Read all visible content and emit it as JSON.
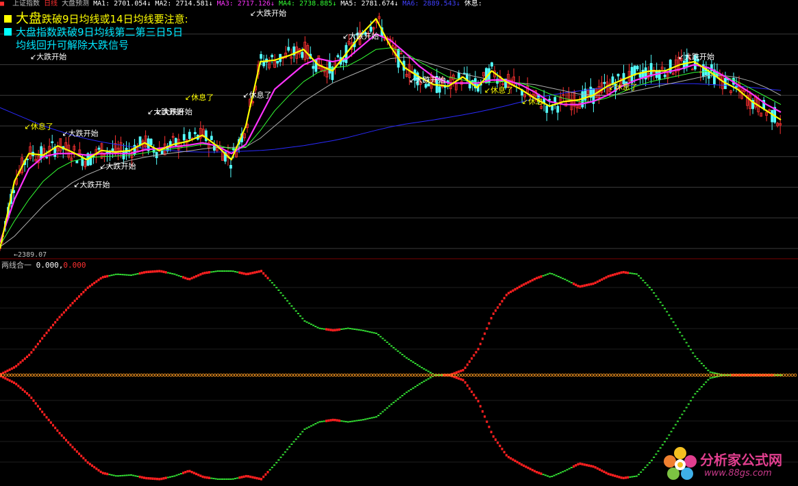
{
  "header": {
    "items": [
      {
        "text": "上证指数",
        "color": "#c0c0c0"
      },
      {
        "text": "日线",
        "color": "#ff3030"
      },
      {
        "text": "大盘预测",
        "color": "#c0c0c0"
      },
      {
        "text": "MA1: 2701.054↓",
        "color": "#ffffff"
      },
      {
        "text": "MA2: 2714.581↓",
        "color": "#ffffff"
      },
      {
        "text": "MA3: 2717.126↓",
        "color": "#ff33ff"
      },
      {
        "text": "MA4: 2738.885↓",
        "color": "#33ff33"
      },
      {
        "text": "MA5: 2781.674↓",
        "color": "#ffffff"
      },
      {
        "text": "MA6: 2889.543↓",
        "color": "#4040ff"
      },
      {
        "text": "休息:",
        "color": "#ffffff"
      }
    ]
  },
  "legend": {
    "line1_square_color": "#ffff00",
    "line1_big": "大盘",
    "line1_rest": "跌破9日均线或14日均线要注意:",
    "line2_square_color": "#00ffff",
    "line2": "大盘指数跌破9日均线第二第三日5日",
    "line3": "均线回升可解除大跌信号"
  },
  "main_chart": {
    "low_label": "2389.07",
    "y_range": [
      2380,
      3180
    ],
    "annotations": [
      {
        "text": "大跌开始",
        "x": 18,
        "y": 3018,
        "color": "#ffffff"
      },
      {
        "text": "大跌开始",
        "x": 40,
        "y": 2768,
        "color": "#ffffff"
      },
      {
        "text": "大跌开始",
        "x": 48,
        "y": 2600,
        "color": "#ffffff"
      },
      {
        "text": "大跌开始",
        "x": 66,
        "y": 2660,
        "color": "#ffffff"
      },
      {
        "text": "大跌开始",
        "x": 99,
        "y": 2838,
        "color": "#ffffff"
      },
      {
        "text": "大跌开始",
        "x": 105,
        "y": 2838,
        "color": "#ffffff"
      },
      {
        "text": "大跌开始",
        "x": 170,
        "y": 3160,
        "color": "#ffffff"
      },
      {
        "text": "大跌开始",
        "x": 234,
        "y": 3085,
        "color": "#ffffff"
      },
      {
        "text": "大跌开始",
        "x": 280,
        "y": 2942,
        "color": "#ffffff"
      },
      {
        "text": "大跌开始",
        "x": 466,
        "y": 3018,
        "color": "#ffffff"
      },
      {
        "text": "休息了",
        "x": 14,
        "y": 2790,
        "color": "#ffff00"
      },
      {
        "text": "休息了",
        "x": 125,
        "y": 2885,
        "color": "#ffff00"
      },
      {
        "text": "休息了",
        "x": 165,
        "y": 2893,
        "color": "#ffffff"
      },
      {
        "text": "休息了",
        "x": 332,
        "y": 2908,
        "color": "#ffff00"
      },
      {
        "text": "休息",
        "x": 358,
        "y": 2872,
        "color": "#ffff00"
      },
      {
        "text": "休息了",
        "x": 418,
        "y": 2918,
        "color": "#ffff00"
      }
    ]
  },
  "sub_chart": {
    "title": "两线合一",
    "value1": "0.000,",
    "value1_color": "#ffffff",
    "value2": "0.000",
    "value2_color": "#ff3030"
  },
  "chart_data": {
    "type": "line",
    "x": [
      0,
      10,
      20,
      30,
      40,
      50,
      60,
      70,
      80,
      90,
      100,
      110,
      120,
      130,
      140,
      150,
      160,
      170,
      180,
      190,
      200,
      210,
      220,
      230,
      240,
      250,
      260,
      270,
      280,
      290,
      300,
      310,
      320,
      330,
      340,
      350,
      360,
      370,
      380,
      390,
      400,
      410,
      420,
      430,
      440,
      450,
      460,
      470,
      480,
      490,
      500,
      510,
      520,
      530,
      540
    ],
    "series": [
      {
        "name": "MA1",
        "color": "#ffff00",
        "values": [
          2400,
          2620,
          2710,
          2705,
          2735,
          2715,
          2690,
          2720,
          2715,
          2720,
          2745,
          2720,
          2740,
          2750,
          2770,
          2735,
          2690,
          2800,
          3010,
          3015,
          3030,
          3050,
          3000,
          2980,
          3040,
          3100,
          3150,
          3060,
          2990,
          2960,
          2935,
          2930,
          2960,
          2925,
          2980,
          2945,
          2920,
          2890,
          2865,
          2880,
          2885,
          2900,
          2930,
          2950,
          2970,
          2980,
          2980,
          3000,
          3010,
          2980,
          2945,
          2920,
          2880,
          2850,
          2820
        ]
      },
      {
        "name": "MA3",
        "color": "#ff33ff",
        "values": [
          2420,
          2560,
          2660,
          2700,
          2710,
          2710,
          2705,
          2710,
          2710,
          2710,
          2722,
          2727,
          2732,
          2737,
          2745,
          2735,
          2710,
          2740,
          2830,
          2920,
          2960,
          3000,
          3020,
          3010,
          3020,
          3060,
          3100,
          3080,
          3040,
          2995,
          2960,
          2940,
          2940,
          2940,
          2950,
          2950,
          2935,
          2910,
          2880,
          2870,
          2870,
          2880,
          2900,
          2930,
          2950,
          2965,
          2975,
          2985,
          3000,
          2990,
          2965,
          2935,
          2905,
          2870,
          2845
        ]
      },
      {
        "name": "MA4",
        "color": "#33ff33",
        "values": [
          2410,
          2490,
          2560,
          2620,
          2660,
          2685,
          2695,
          2700,
          2702,
          2705,
          2712,
          2720,
          2726,
          2732,
          2740,
          2738,
          2725,
          2730,
          2785,
          2850,
          2900,
          2945,
          2975,
          2990,
          2995,
          3020,
          3050,
          3055,
          3040,
          3010,
          2985,
          2960,
          2950,
          2942,
          2943,
          2945,
          2940,
          2925,
          2905,
          2890,
          2880,
          2880,
          2892,
          2910,
          2930,
          2945,
          2955,
          2965,
          2975,
          2978,
          2965,
          2945,
          2920,
          2895,
          2870
        ]
      },
      {
        "name": "MA5",
        "color": "#b0b0b0",
        "values": [
          2405,
          2440,
          2490,
          2540,
          2580,
          2615,
          2640,
          2660,
          2675,
          2688,
          2698,
          2706,
          2712,
          2718,
          2725,
          2730,
          2730,
          2732,
          2760,
          2800,
          2840,
          2880,
          2910,
          2940,
          2960,
          2980,
          3000,
          3020,
          3025,
          3015,
          3000,
          2985,
          2970,
          2960,
          2950,
          2945,
          2940,
          2935,
          2925,
          2915,
          2905,
          2900,
          2900,
          2905,
          2915,
          2925,
          2935,
          2945,
          2955,
          2965,
          2965,
          2958,
          2945,
          2925,
          2900
        ]
      },
      {
        "name": "MA6",
        "color": "#2a2aff",
        "values": [
          2860,
          2840,
          2820,
          2800,
          2785,
          2770,
          2758,
          2748,
          2740,
          2733,
          2727,
          2722,
          2719,
          2716,
          2715,
          2715,
          2716,
          2718,
          2720,
          2724,
          2730,
          2736,
          2744,
          2752,
          2762,
          2774,
          2786,
          2797,
          2806,
          2813,
          2820,
          2828,
          2836,
          2845,
          2855,
          2866,
          2878,
          2890,
          2900,
          2908,
          2914,
          2920,
          2926,
          2930,
          2934,
          2936,
          2938,
          2938,
          2938,
          2936,
          2933,
          2930,
          2926,
          2921,
          2916
        ]
      }
    ],
    "oscillator": {
      "title": "两线合一",
      "x": [
        0,
        10,
        20,
        30,
        40,
        50,
        60,
        70,
        80,
        90,
        100,
        110,
        120,
        130,
        140,
        150,
        160,
        170,
        180,
        190,
        200,
        210,
        220,
        230,
        240,
        250,
        260,
        270,
        280,
        290,
        300,
        310,
        320,
        330,
        340,
        350,
        360,
        370,
        380,
        390,
        400,
        410,
        420,
        430,
        440,
        450,
        460,
        470,
        480,
        490,
        500,
        510,
        520,
        530,
        540
      ],
      "values": [
        0.01,
        0.08,
        0.2,
        0.38,
        0.55,
        0.7,
        0.84,
        0.94,
        0.97,
        0.96,
        0.99,
        1.0,
        0.97,
        0.92,
        0.98,
        1.0,
        1.0,
        0.97,
        1.0,
        0.85,
        0.68,
        0.52,
        0.45,
        0.43,
        0.45,
        0.43,
        0.4,
        0.28,
        0.17,
        0.08,
        0.0,
        0.0,
        0.05,
        0.25,
        0.58,
        0.78,
        0.86,
        0.93,
        0.98,
        0.92,
        0.85,
        0.88,
        0.95,
        0.99,
        0.97,
        0.82,
        0.62,
        0.4,
        0.18,
        0.03,
        0.0,
        0.0,
        0.0,
        0.0,
        0.0
      ],
      "colors": [
        "r",
        "r",
        "r",
        "r",
        "r",
        "r",
        "r",
        "r",
        "g",
        "g",
        "r",
        "r",
        "g",
        "r",
        "r",
        "g",
        "g",
        "r",
        "r",
        "g",
        "g",
        "g",
        "g",
        "r",
        "g",
        "g",
        "g",
        "g",
        "g",
        "g",
        "g",
        "r",
        "r",
        "r",
        "r",
        "r",
        "r",
        "r",
        "g",
        "g",
        "r",
        "r",
        "r",
        "r",
        "g",
        "g",
        "g",
        "g",
        "g",
        "g",
        "g",
        "r",
        "r",
        "r",
        "g"
      ],
      "red": "#ff2020",
      "green": "#33dd33",
      "mirror": true
    },
    "ylim": [
      2380,
      3180
    ],
    "grid": true
  },
  "watermark": {
    "title": "分析家公式网",
    "url": "www.88gs.com"
  }
}
